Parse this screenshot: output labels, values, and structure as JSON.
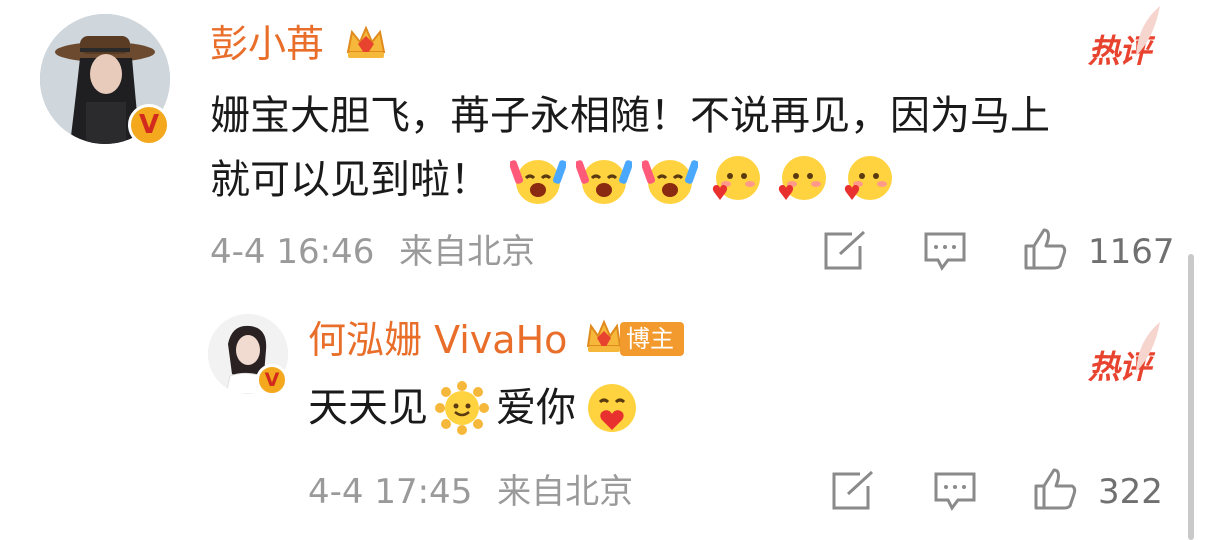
{
  "comment": {
    "username": "彭小苒",
    "hot_label": "热评",
    "text_line1": "姗宝大胆飞，苒子永相随！不说再见，因为马上",
    "text_line2": "就可以见到啦！",
    "emojis": [
      "cheer-emoji",
      "cheer-emoji",
      "cheer-emoji",
      "heart-cute-emoji",
      "heart-cute-emoji",
      "heart-cute-emoji"
    ],
    "time": "4-4 16:46",
    "location": "来自北京",
    "like_count": "1167"
  },
  "reply": {
    "username": "何泓姗 VivaHo",
    "badge_label": "博主",
    "hot_label": "热评",
    "text_part1": "天天见",
    "text_part2": "爱你",
    "time": "4-4 17:45",
    "location": "来自北京",
    "like_count": "322"
  },
  "colors": {
    "username": "#e86e2a",
    "hot": "#e8432f",
    "meta": "#9a9a9a",
    "badge": "#f29a2e"
  }
}
